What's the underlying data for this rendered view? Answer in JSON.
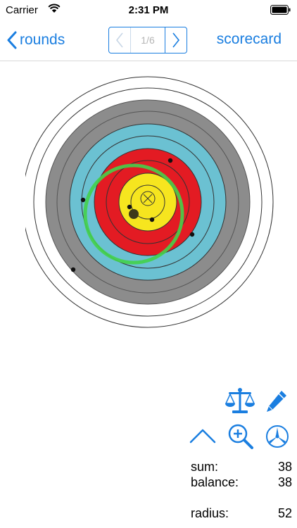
{
  "status": {
    "carrier": "Carrier",
    "time": "2:31 PM"
  },
  "nav": {
    "back_label": "rounds",
    "pager_label": "1/6",
    "scorecard_label": "scorecard"
  },
  "stats": {
    "sum_label": "sum:",
    "sum_value": "38",
    "balance_label": "balance:",
    "balance_value": "38",
    "radius_label": "radius:",
    "radius_value": "52"
  },
  "icons": {
    "balance": "balance-scale-icon",
    "edit": "pencil-icon",
    "collapse": "chevron-up-icon",
    "zoom": "zoom-in-icon",
    "mode": "three-spoke-icon"
  },
  "colors": {
    "accent": "#1a7ee0",
    "ring_white": "#ffffff",
    "ring_black": "#8c8c8c",
    "ring_blue": "#6bc1d2",
    "ring_red": "#e31b23",
    "ring_gold": "#f6e51f",
    "group_circle": "#44d14a"
  }
}
